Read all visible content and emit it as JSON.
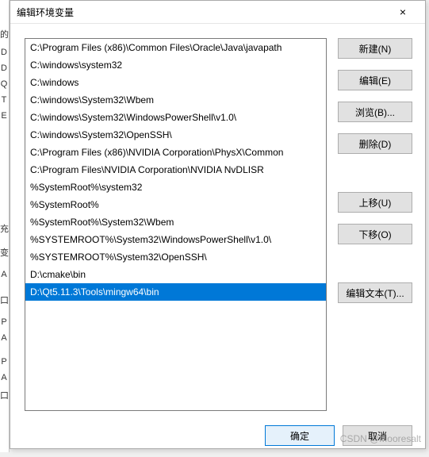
{
  "window": {
    "title": "编辑环境变量",
    "close_label": "×"
  },
  "background_labels": [
    "的",
    "D",
    "D",
    "Q",
    "T",
    "E",
    "充",
    "变",
    "A",
    "口",
    "P",
    "A",
    "P",
    "A",
    "口"
  ],
  "paths": [
    {
      "text": "C:\\Program Files (x86)\\Common Files\\Oracle\\Java\\javapath",
      "selected": false
    },
    {
      "text": "C:\\windows\\system32",
      "selected": false
    },
    {
      "text": "C:\\windows",
      "selected": false
    },
    {
      "text": "C:\\windows\\System32\\Wbem",
      "selected": false
    },
    {
      "text": "C:\\windows\\System32\\WindowsPowerShell\\v1.0\\",
      "selected": false
    },
    {
      "text": "C:\\windows\\System32\\OpenSSH\\",
      "selected": false
    },
    {
      "text": "C:\\Program Files (x86)\\NVIDIA Corporation\\PhysX\\Common",
      "selected": false
    },
    {
      "text": "C:\\Program Files\\NVIDIA Corporation\\NVIDIA NvDLISR",
      "selected": false
    },
    {
      "text": "%SystemRoot%\\system32",
      "selected": false
    },
    {
      "text": "%SystemRoot%",
      "selected": false
    },
    {
      "text": "%SystemRoot%\\System32\\Wbem",
      "selected": false
    },
    {
      "text": "%SYSTEMROOT%\\System32\\WindowsPowerShell\\v1.0\\",
      "selected": false
    },
    {
      "text": "%SYSTEMROOT%\\System32\\OpenSSH\\",
      "selected": false
    },
    {
      "text": "D:\\cmake\\bin",
      "selected": false
    },
    {
      "text": "D:\\Qt5.11.3\\Tools\\mingw64\\bin",
      "selected": true
    }
  ],
  "buttons": {
    "new": "新建(N)",
    "edit": "编辑(E)",
    "browse": "浏览(B)...",
    "delete": "删除(D)",
    "move_up": "上移(U)",
    "move_down": "下移(O)",
    "edit_text": "编辑文本(T)..."
  },
  "footer": {
    "ok": "确定",
    "cancel": "取消"
  },
  "watermark": "CSDN @Mooresalt"
}
